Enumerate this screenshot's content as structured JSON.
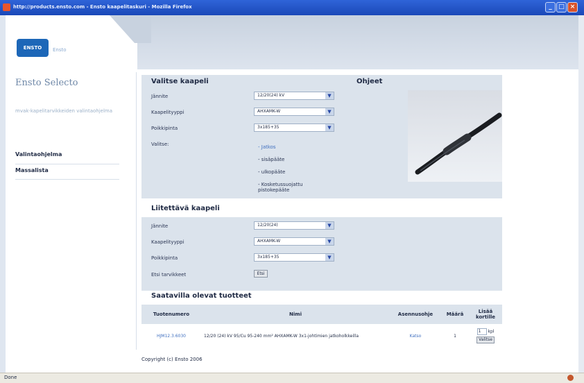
{
  "window": {
    "title": "http://products.ensto.com - Ensto kaapelitaskuri - Mozilla Firefox",
    "controls": {
      "minimize": "_",
      "maximize": "□",
      "close": "×"
    }
  },
  "header": {
    "logo_text": "ENSTO",
    "logo_sub": "Ensto"
  },
  "sidebar": {
    "title": "Ensto Selecto",
    "description": "mvak-kapelitarvikkeiden valintaohjelma",
    "items": [
      {
        "label": "Valintaohjelma"
      },
      {
        "label": "Massalista"
      }
    ]
  },
  "cable_section": {
    "heading": "Valitse kaapeli",
    "rows": [
      {
        "label": "Jännite",
        "value": "12/20(24) kV"
      },
      {
        "label": "Kaapelityyppi",
        "value": "AHXAMK-W"
      },
      {
        "label": "Poikkipinta",
        "value": "3x185+35"
      }
    ],
    "choice_label": "Valitse:",
    "choices": [
      {
        "label": "- Jatkos"
      },
      {
        "label": "- sisäpääte"
      },
      {
        "label": "- ulkopääte"
      },
      {
        "label": "- Kosketussuojattu pistokepääte"
      }
    ]
  },
  "help": {
    "heading": "Ohjeet",
    "image_desc": "cable joint photo"
  },
  "joined_section": {
    "heading": "Liitettävä kaapeli",
    "rows": [
      {
        "label": "Jännite",
        "value": "12/20(24)"
      },
      {
        "label": "Kaapelityyppi",
        "value": "AHXAMK-W"
      },
      {
        "label": "Poikkipinta",
        "value": "3x185+35"
      }
    ],
    "search_label": "Etsi tarvikkeet",
    "search_button": "Etsi"
  },
  "products": {
    "heading": "Saatavilla olevat tuotteet",
    "columns": [
      "Tuotenumero",
      "Nimi",
      "Asennusohje",
      "Määrä",
      "Lisää kortille"
    ],
    "rows": [
      {
        "number": "HJM12.3.6030",
        "name": "12/20 (24) kV 95/Cu 95-240 mm² AHXAMK-W 3x1-johtimien jatkoholkkeilla",
        "instructions": "Katso",
        "amount": "1",
        "qty_value": "1",
        "qty_unit": "kpl",
        "add_button": "Valitse"
      }
    ]
  },
  "footer": {
    "copyright": "Copyright (c) Ensto 2006"
  },
  "statusbar": {
    "text": "Done"
  }
}
